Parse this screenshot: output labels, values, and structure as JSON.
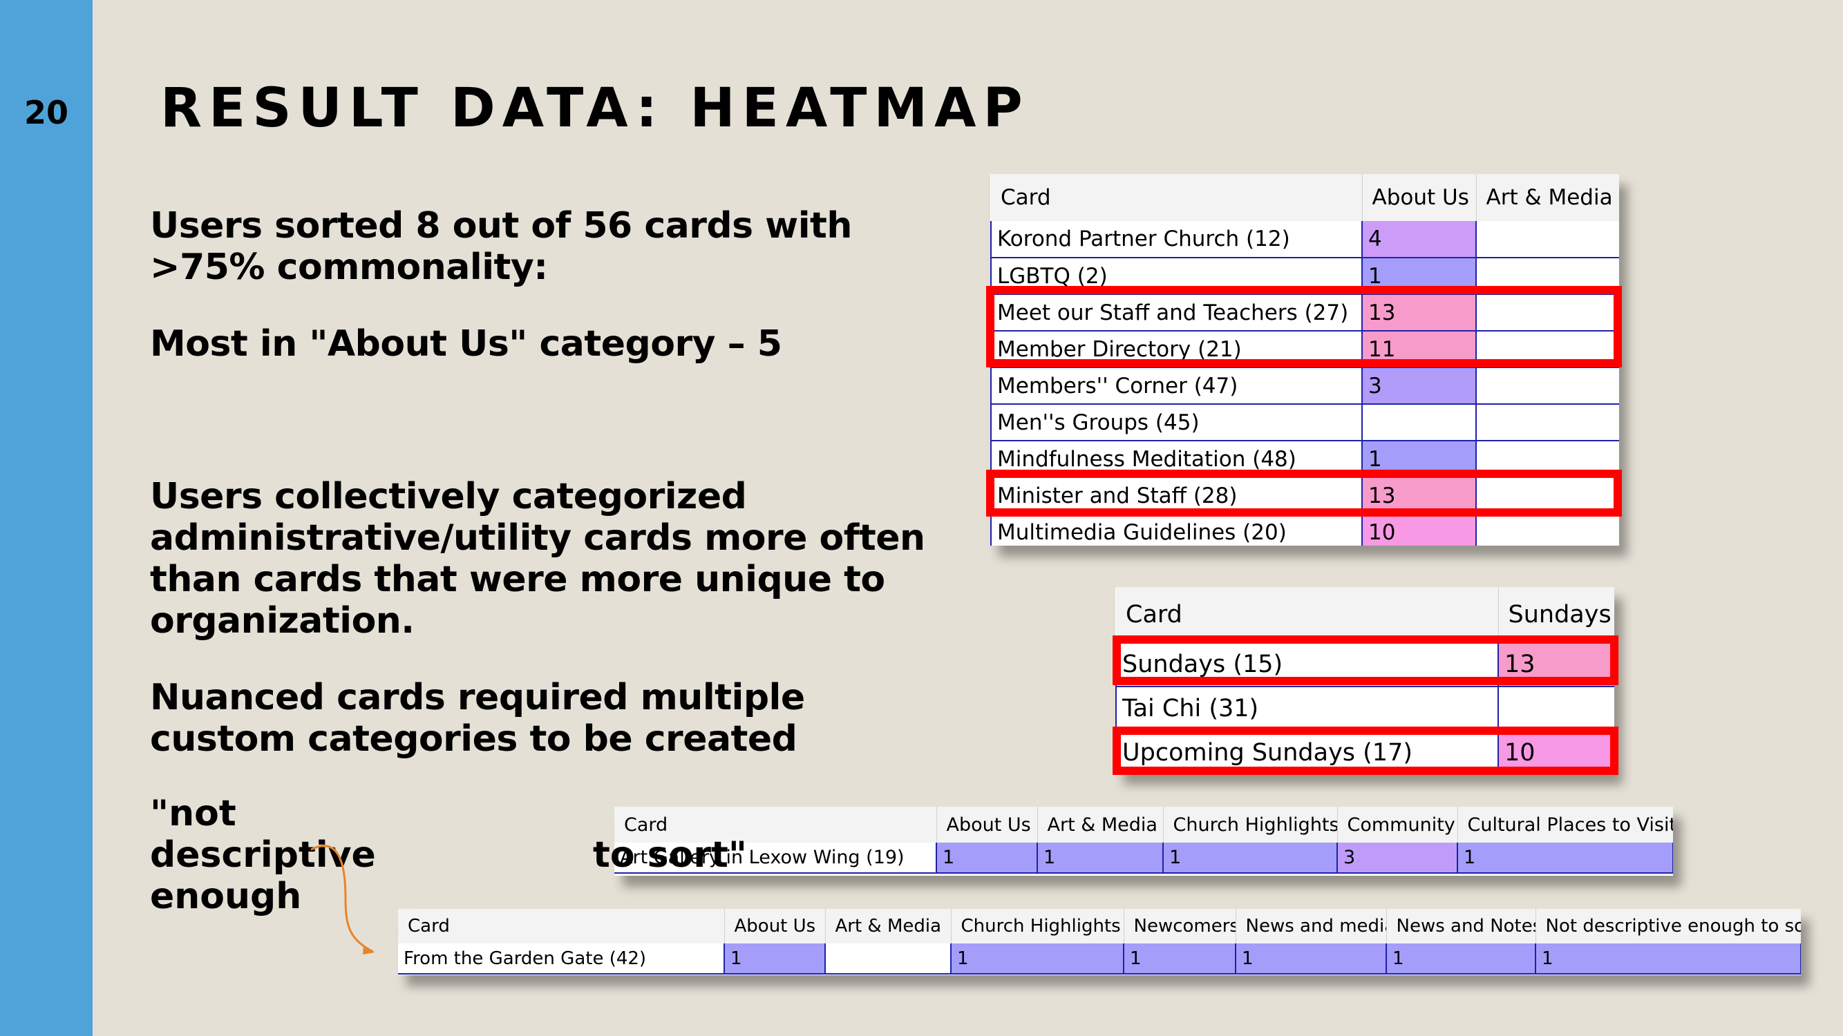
{
  "slide_number": "20",
  "title": "RESULT DATA: HEATMAP",
  "paragraphs": {
    "p1": "Users sorted 8 out of 56 cards with >75% commonality:",
    "p2": "Most in \"About Us\" category – 5",
    "p3": "Users collectively categorized administrative/utility cards more often than cards that were more unique to organization.",
    "p4": "Nuanced cards required multiple custom categories to be created",
    "quote_start": "\"not descriptive enough",
    "quote_end": "to sort\""
  },
  "colors": {
    "sidebar": "#4fa3d9",
    "background": "#e5e0d5",
    "highlight_box": "#ff0000",
    "cell_low": "#a49dfa",
    "cell_mid": "#cd9cf9",
    "cell_high": "#f79bca",
    "cell_pink": "#f799e4",
    "arrow": "#e8842a"
  },
  "table1": {
    "headers": [
      "Card",
      "About Us",
      "Art & Media"
    ],
    "rows": [
      {
        "card": "Korond Partner Church (12)",
        "about": "4",
        "art": ""
      },
      {
        "card": "LGBTQ (2)",
        "about": "1",
        "art": ""
      },
      {
        "card": "Meet our Staff and Teachers (27)",
        "about": "13",
        "art": ""
      },
      {
        "card": "Member Directory (21)",
        "about": "11",
        "art": ""
      },
      {
        "card": "Members'' Corner (47)",
        "about": "3",
        "art": ""
      },
      {
        "card": "Men''s Groups (45)",
        "about": "",
        "art": ""
      },
      {
        "card": "Mindfulness Meditation (48)",
        "about": "1",
        "art": ""
      },
      {
        "card": "Minister and Staff (28)",
        "about": "13",
        "art": ""
      },
      {
        "card": "Multimedia Guidelines (20)",
        "about": "10",
        "art": ""
      }
    ]
  },
  "table2": {
    "headers": [
      "Card",
      "Sundays"
    ],
    "rows": [
      {
        "card": "Sundays (15)",
        "value": "13"
      },
      {
        "card": "Tai Chi (31)",
        "value": ""
      },
      {
        "card": "Upcoming Sundays (17)",
        "value": "10"
      }
    ]
  },
  "table3": {
    "headers": [
      "Card",
      "About Us",
      "Art & Media",
      "Church Highlights",
      "Community",
      "Cultural Places to Visit"
    ],
    "row": [
      "Art Gallery in Lexow Wing (19)",
      "1",
      "1",
      "1",
      "3",
      "1"
    ]
  },
  "table4": {
    "headers": [
      "Card",
      "About Us",
      "Art & Media",
      "Church Highlights",
      "Newcomers",
      "News and media",
      "News and Notes",
      "Not descriptive enough to sort"
    ],
    "row": [
      "From the Garden Gate (42)",
      "1",
      "",
      "1",
      "1",
      "1",
      "1",
      "1"
    ]
  }
}
